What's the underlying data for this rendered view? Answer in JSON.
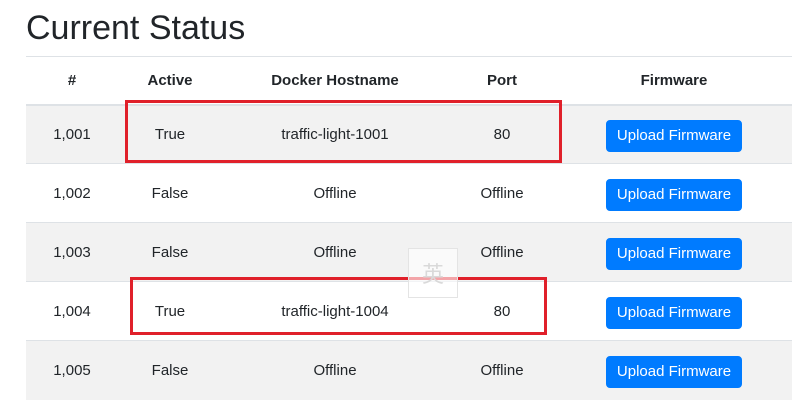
{
  "page": {
    "title": "Current Status"
  },
  "table": {
    "headers": {
      "id": "#",
      "active": "Active",
      "hostname": "Docker Hostname",
      "port": "Port",
      "firmware": "Firmware"
    },
    "rows": [
      {
        "id": "1,001",
        "active": "True",
        "hostname": "traffic-light-1001",
        "port": "80",
        "button": "Upload Firmware"
      },
      {
        "id": "1,002",
        "active": "False",
        "hostname": "Offline",
        "port": "Offline",
        "button": "Upload Firmware"
      },
      {
        "id": "1,003",
        "active": "False",
        "hostname": "Offline",
        "port": "Offline",
        "button": "Upload Firmware"
      },
      {
        "id": "1,004",
        "active": "True",
        "hostname": "traffic-light-1004",
        "port": "80",
        "button": "Upload Firmware"
      },
      {
        "id": "1,005",
        "active": "False",
        "hostname": "Offline",
        "port": "Offline",
        "button": "Upload Firmware"
      }
    ]
  },
  "overlay": {
    "ime_char": "英",
    "highlight_color": "#e0202a"
  },
  "colors": {
    "button_primary": "#007bff",
    "stripe": "#f2f2f2",
    "border": "#dee2e6"
  }
}
